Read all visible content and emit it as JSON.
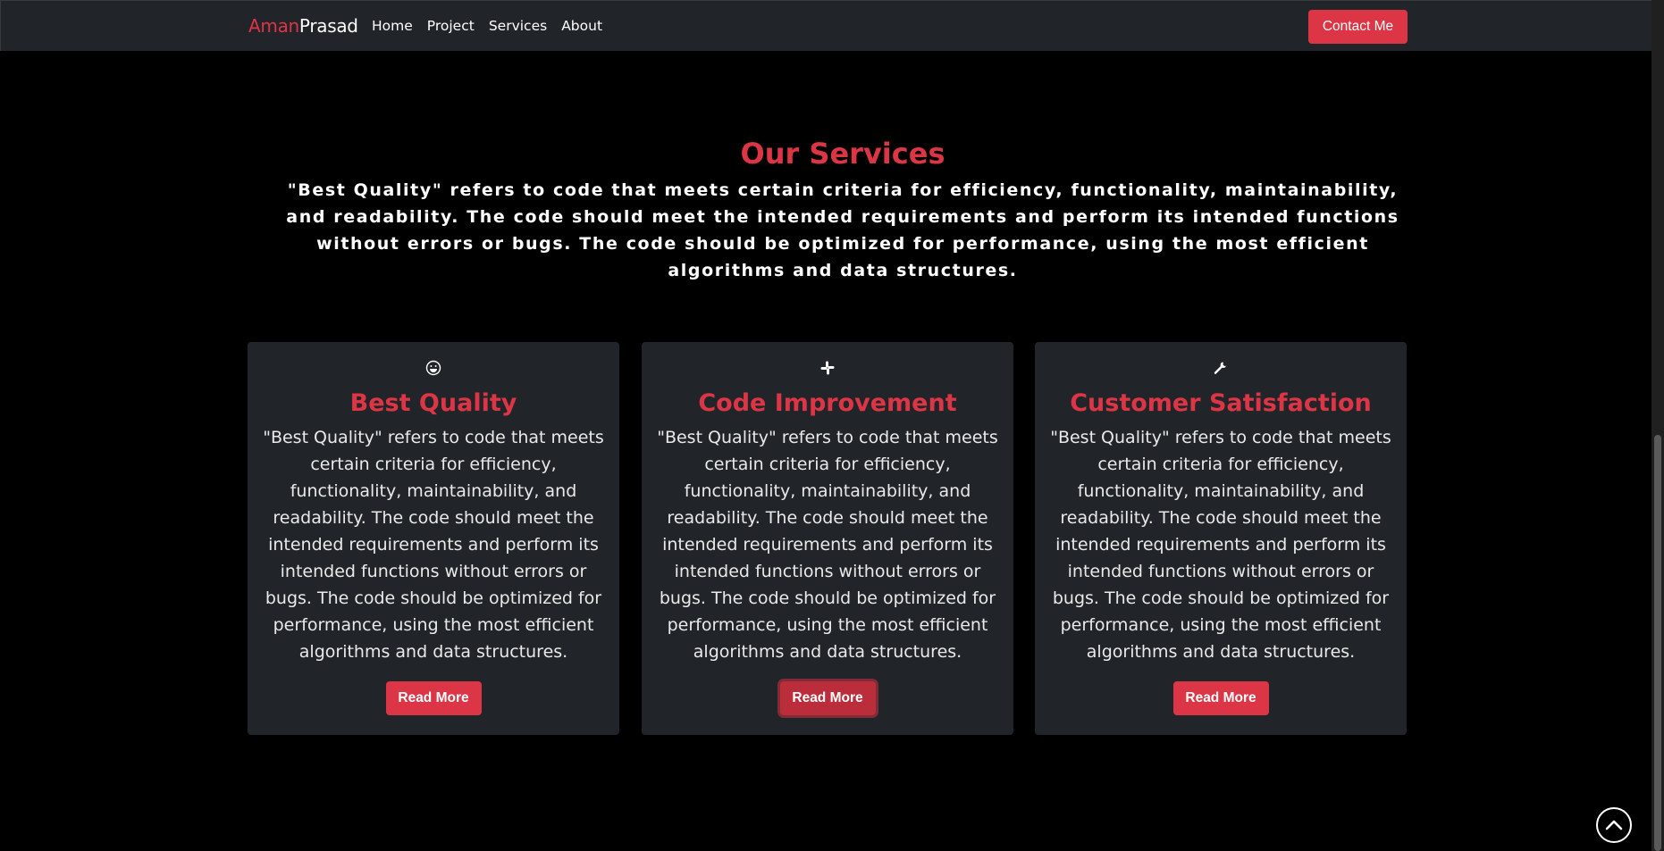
{
  "navbar": {
    "brand_first": "Aman",
    "brand_last": "Prasad",
    "links": [
      "Home",
      "Project",
      "Services",
      "About"
    ],
    "contact_label": "Contact Me"
  },
  "services": {
    "title": "Our Services",
    "description": "\"Best Quality\" refers to code that meets certain criteria for efficiency, functionality, maintainability, and readability. The code should meet the intended requirements and perform its intended functions without errors or bugs. The code should be optimized for performance, using the most efficient algorithms and data structures.",
    "cards": [
      {
        "icon": "smile-icon",
        "title": "Best Quality",
        "text": "\"Best Quality\" refers to code that meets certain criteria for efficiency, functionality, maintainability, and readability. The code should meet the intended requirements and perform its intended functions without errors or bugs. The code should be optimized for performance, using the most efficient algorithms and data structures.",
        "button": "Read More"
      },
      {
        "icon": "slack-icon",
        "title": "Code Improvement",
        "text": "\"Best Quality\" refers to code that meets certain criteria for efficiency, functionality, maintainability, and readability. The code should meet the intended requirements and perform its intended functions without errors or bugs. The code should be optimized for performance, using the most efficient algorithms and data structures.",
        "button": "Read More"
      },
      {
        "icon": "wrench-icon",
        "title": "Customer Satisfaction",
        "text": "\"Best Quality\" refers to code that meets certain criteria for efficiency, functionality, maintainability, and readability. The code should meet the intended requirements and perform its intended functions without errors or bugs. The code should be optimized for performance, using the most efficient algorithms and data structures.",
        "button": "Read More"
      }
    ]
  },
  "back_to_top_icon": "chevron-up-circle-icon",
  "colors": {
    "accent": "#dc3545",
    "navbar_bg": "#212529",
    "card_bg": "#212529",
    "page_bg": "#000000"
  }
}
